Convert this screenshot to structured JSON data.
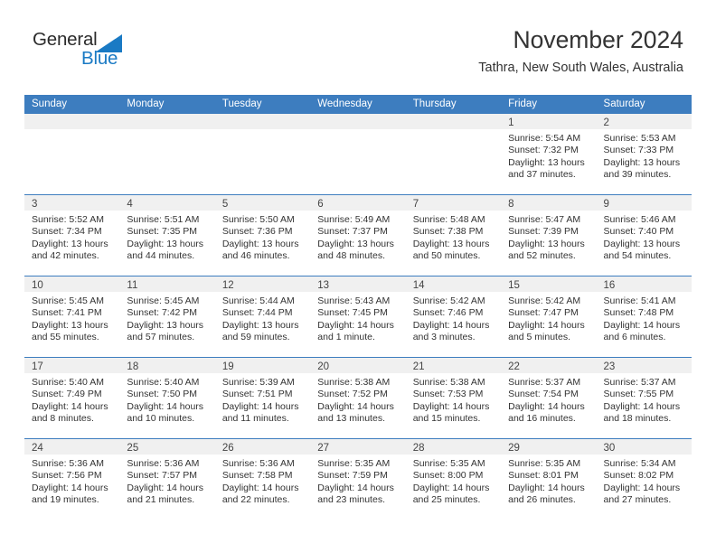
{
  "brand": {
    "name_part1": "General",
    "name_part2": "Blue",
    "triangle_color": "#1a7ac4",
    "text_color": "#2b2b2b",
    "blue_color": "#1a7ac4"
  },
  "header": {
    "title": "November 2024",
    "subtitle": "Tathra, New South Wales, Australia"
  },
  "theme": {
    "header_bg": "#3d7dbf",
    "header_text": "#ffffff",
    "daynum_strip_bg": "#f0f0f0",
    "cell_bg": "#ffffff",
    "row_border": "#3d7dbf",
    "body_text": "#333333"
  },
  "weekdays": [
    "Sunday",
    "Monday",
    "Tuesday",
    "Wednesday",
    "Thursday",
    "Friday",
    "Saturday"
  ],
  "weeks": [
    [
      {
        "day": "",
        "lines": []
      },
      {
        "day": "",
        "lines": []
      },
      {
        "day": "",
        "lines": []
      },
      {
        "day": "",
        "lines": []
      },
      {
        "day": "",
        "lines": []
      },
      {
        "day": "1",
        "lines": [
          "Sunrise: 5:54 AM",
          "Sunset: 7:32 PM",
          "Daylight: 13 hours",
          "and 37 minutes."
        ]
      },
      {
        "day": "2",
        "lines": [
          "Sunrise: 5:53 AM",
          "Sunset: 7:33 PM",
          "Daylight: 13 hours",
          "and 39 minutes."
        ]
      }
    ],
    [
      {
        "day": "3",
        "lines": [
          "Sunrise: 5:52 AM",
          "Sunset: 7:34 PM",
          "Daylight: 13 hours",
          "and 42 minutes."
        ]
      },
      {
        "day": "4",
        "lines": [
          "Sunrise: 5:51 AM",
          "Sunset: 7:35 PM",
          "Daylight: 13 hours",
          "and 44 minutes."
        ]
      },
      {
        "day": "5",
        "lines": [
          "Sunrise: 5:50 AM",
          "Sunset: 7:36 PM",
          "Daylight: 13 hours",
          "and 46 minutes."
        ]
      },
      {
        "day": "6",
        "lines": [
          "Sunrise: 5:49 AM",
          "Sunset: 7:37 PM",
          "Daylight: 13 hours",
          "and 48 minutes."
        ]
      },
      {
        "day": "7",
        "lines": [
          "Sunrise: 5:48 AM",
          "Sunset: 7:38 PM",
          "Daylight: 13 hours",
          "and 50 minutes."
        ]
      },
      {
        "day": "8",
        "lines": [
          "Sunrise: 5:47 AM",
          "Sunset: 7:39 PM",
          "Daylight: 13 hours",
          "and 52 minutes."
        ]
      },
      {
        "day": "9",
        "lines": [
          "Sunrise: 5:46 AM",
          "Sunset: 7:40 PM",
          "Daylight: 13 hours",
          "and 54 minutes."
        ]
      }
    ],
    [
      {
        "day": "10",
        "lines": [
          "Sunrise: 5:45 AM",
          "Sunset: 7:41 PM",
          "Daylight: 13 hours",
          "and 55 minutes."
        ]
      },
      {
        "day": "11",
        "lines": [
          "Sunrise: 5:45 AM",
          "Sunset: 7:42 PM",
          "Daylight: 13 hours",
          "and 57 minutes."
        ]
      },
      {
        "day": "12",
        "lines": [
          "Sunrise: 5:44 AM",
          "Sunset: 7:44 PM",
          "Daylight: 13 hours",
          "and 59 minutes."
        ]
      },
      {
        "day": "13",
        "lines": [
          "Sunrise: 5:43 AM",
          "Sunset: 7:45 PM",
          "Daylight: 14 hours",
          "and 1 minute."
        ]
      },
      {
        "day": "14",
        "lines": [
          "Sunrise: 5:42 AM",
          "Sunset: 7:46 PM",
          "Daylight: 14 hours",
          "and 3 minutes."
        ]
      },
      {
        "day": "15",
        "lines": [
          "Sunrise: 5:42 AM",
          "Sunset: 7:47 PM",
          "Daylight: 14 hours",
          "and 5 minutes."
        ]
      },
      {
        "day": "16",
        "lines": [
          "Sunrise: 5:41 AM",
          "Sunset: 7:48 PM",
          "Daylight: 14 hours",
          "and 6 minutes."
        ]
      }
    ],
    [
      {
        "day": "17",
        "lines": [
          "Sunrise: 5:40 AM",
          "Sunset: 7:49 PM",
          "Daylight: 14 hours",
          "and 8 minutes."
        ]
      },
      {
        "day": "18",
        "lines": [
          "Sunrise: 5:40 AM",
          "Sunset: 7:50 PM",
          "Daylight: 14 hours",
          "and 10 minutes."
        ]
      },
      {
        "day": "19",
        "lines": [
          "Sunrise: 5:39 AM",
          "Sunset: 7:51 PM",
          "Daylight: 14 hours",
          "and 11 minutes."
        ]
      },
      {
        "day": "20",
        "lines": [
          "Sunrise: 5:38 AM",
          "Sunset: 7:52 PM",
          "Daylight: 14 hours",
          "and 13 minutes."
        ]
      },
      {
        "day": "21",
        "lines": [
          "Sunrise: 5:38 AM",
          "Sunset: 7:53 PM",
          "Daylight: 14 hours",
          "and 15 minutes."
        ]
      },
      {
        "day": "22",
        "lines": [
          "Sunrise: 5:37 AM",
          "Sunset: 7:54 PM",
          "Daylight: 14 hours",
          "and 16 minutes."
        ]
      },
      {
        "day": "23",
        "lines": [
          "Sunrise: 5:37 AM",
          "Sunset: 7:55 PM",
          "Daylight: 14 hours",
          "and 18 minutes."
        ]
      }
    ],
    [
      {
        "day": "24",
        "lines": [
          "Sunrise: 5:36 AM",
          "Sunset: 7:56 PM",
          "Daylight: 14 hours",
          "and 19 minutes."
        ]
      },
      {
        "day": "25",
        "lines": [
          "Sunrise: 5:36 AM",
          "Sunset: 7:57 PM",
          "Daylight: 14 hours",
          "and 21 minutes."
        ]
      },
      {
        "day": "26",
        "lines": [
          "Sunrise: 5:36 AM",
          "Sunset: 7:58 PM",
          "Daylight: 14 hours",
          "and 22 minutes."
        ]
      },
      {
        "day": "27",
        "lines": [
          "Sunrise: 5:35 AM",
          "Sunset: 7:59 PM",
          "Daylight: 14 hours",
          "and 23 minutes."
        ]
      },
      {
        "day": "28",
        "lines": [
          "Sunrise: 5:35 AM",
          "Sunset: 8:00 PM",
          "Daylight: 14 hours",
          "and 25 minutes."
        ]
      },
      {
        "day": "29",
        "lines": [
          "Sunrise: 5:35 AM",
          "Sunset: 8:01 PM",
          "Daylight: 14 hours",
          "and 26 minutes."
        ]
      },
      {
        "day": "30",
        "lines": [
          "Sunrise: 5:34 AM",
          "Sunset: 8:02 PM",
          "Daylight: 14 hours",
          "and 27 minutes."
        ]
      }
    ]
  ]
}
